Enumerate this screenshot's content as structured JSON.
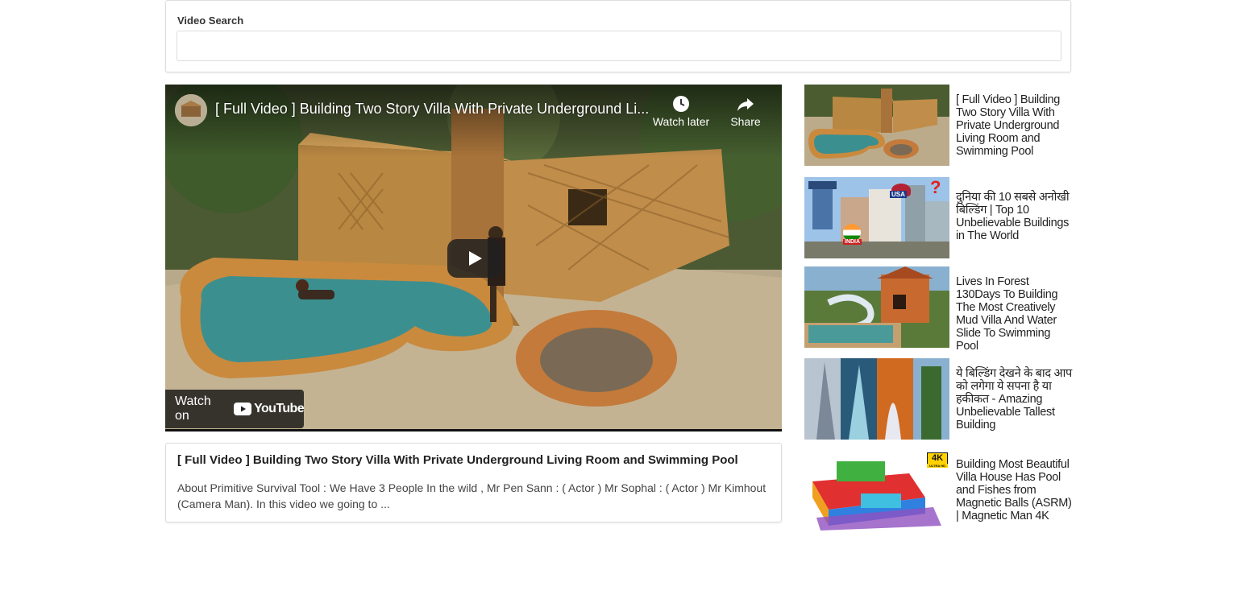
{
  "search": {
    "label": "Video Search",
    "value": "",
    "placeholder": ""
  },
  "player": {
    "title": "[ Full Video ] Building Two Story Villa With Private Underground Li...",
    "watch_later_label": "Watch later",
    "share_label": "Share",
    "watch_on_label": "Watch on",
    "youtube_label": "YouTube"
  },
  "video_info": {
    "title": "[ Full Video ] Building Two Story Villa With Private Underground Living Room and Swimming Pool",
    "description": "About Primitive Survival Tool : We Have 3 People In the wild , Mr Pen Sann : ( Actor ) Mr Sophal : ( Actor ) Mr Kimhout (Camera Man). In this video we going to ..."
  },
  "related": [
    {
      "title": "[ Full Video ] Building Two Story Villa With Private Underground Living Room and Swimming Pool",
      "thumb": "bamboo-villa-pool"
    },
    {
      "title": "दुनिया की 10 सबसे अनोखी बिल्डिंग | Top 10 Unbelievable Buildings in The World",
      "thumb": "unique-buildings",
      "badge_usa": "USA",
      "badge_india": "INDIA",
      "badge_q": "?"
    },
    {
      "title": "Lives In Forest 130Days To Building The Most Creatively Mud Villa And Water Slide To Swimming Pool",
      "thumb": "mud-villa-slide"
    },
    {
      "title": "ये बिल्डिंग देखने के बाद आप को लगेगा ये सपना है या हकीकत - Amazing Unbelievable Tallest Building",
      "thumb": "tall-buildings"
    },
    {
      "title": "Building Most Beautiful Villa House Has Pool and Fishes from Magnetic Balls (ASRM) | Magnetic Man 4K",
      "thumb": "magnetic-villa",
      "badge_4k": "4K",
      "badge_ultra": "ULTRA HD"
    }
  ],
  "colors": {
    "accent_red": "#ff0000",
    "border": "#dddddd",
    "text": "#222222"
  }
}
